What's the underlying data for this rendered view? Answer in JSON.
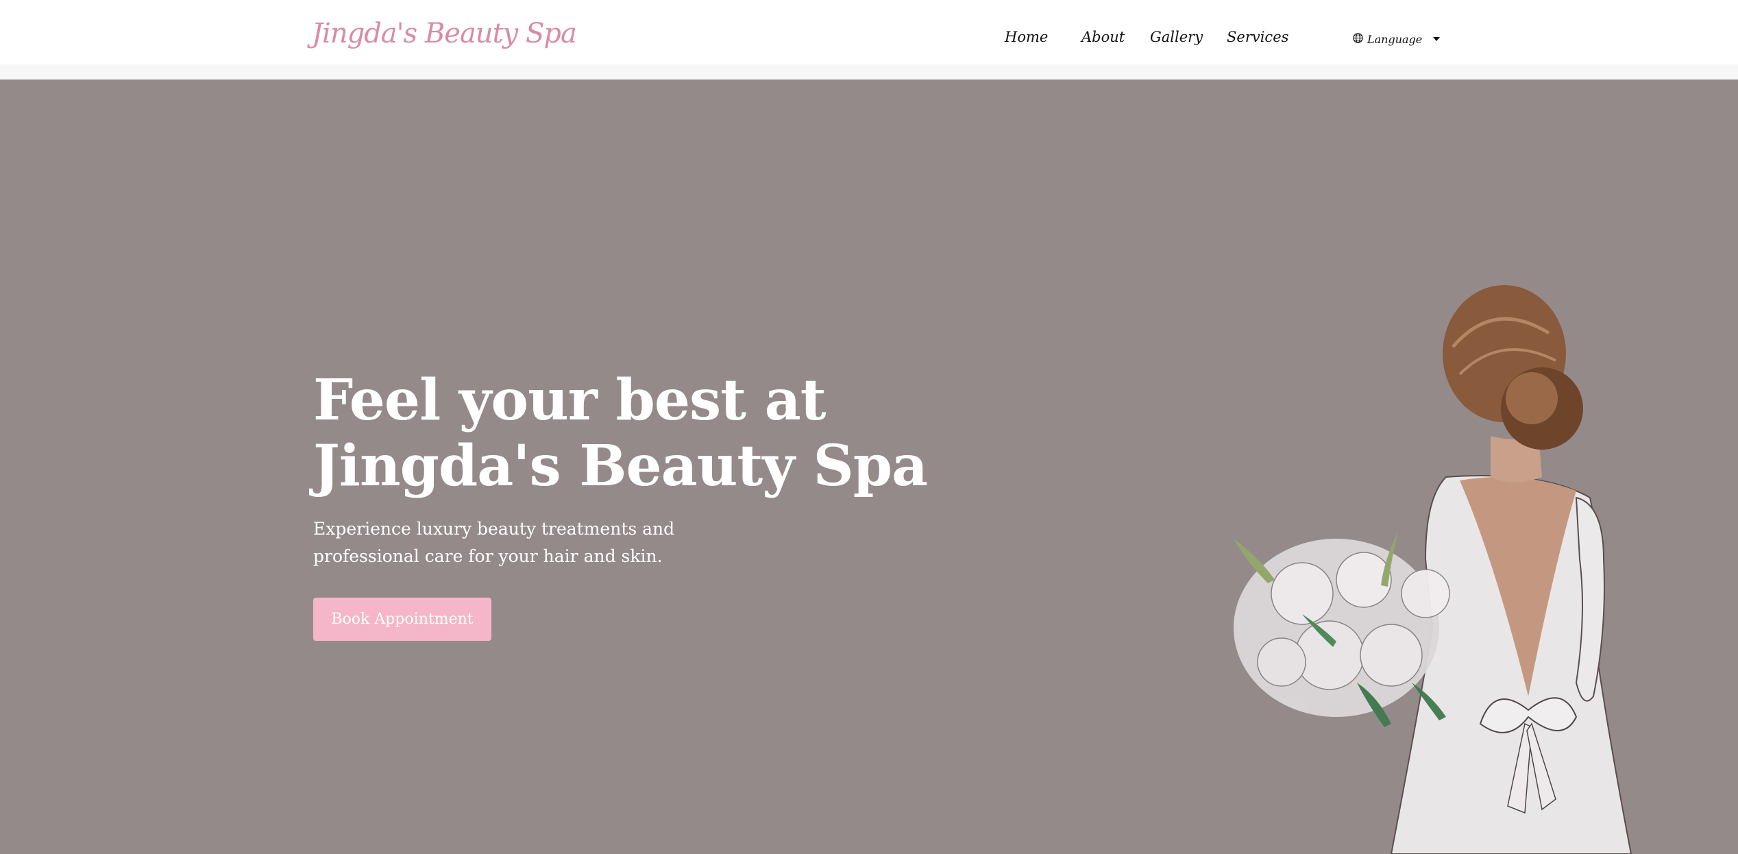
{
  "brand": {
    "name": "Jingda's Beauty Spa"
  },
  "nav": {
    "links": [
      "Home",
      "About",
      "Gallery",
      "Services"
    ],
    "language_label": "Language"
  },
  "hero": {
    "title_line1": "Feel your best at",
    "title_line2": "Jingda's Beauty Spa",
    "subtitle": "Experience luxury beauty treatments and professional care for your hair and skin.",
    "cta_label": "Book Appointment"
  },
  "colors": {
    "brand": "#d98ba5",
    "hero_bg": "#958a8a",
    "cta_bg": "#f4b6c8",
    "text_dark": "#111111"
  },
  "icons": {
    "language": "globe-icon",
    "dropdown": "caret-down-icon"
  }
}
